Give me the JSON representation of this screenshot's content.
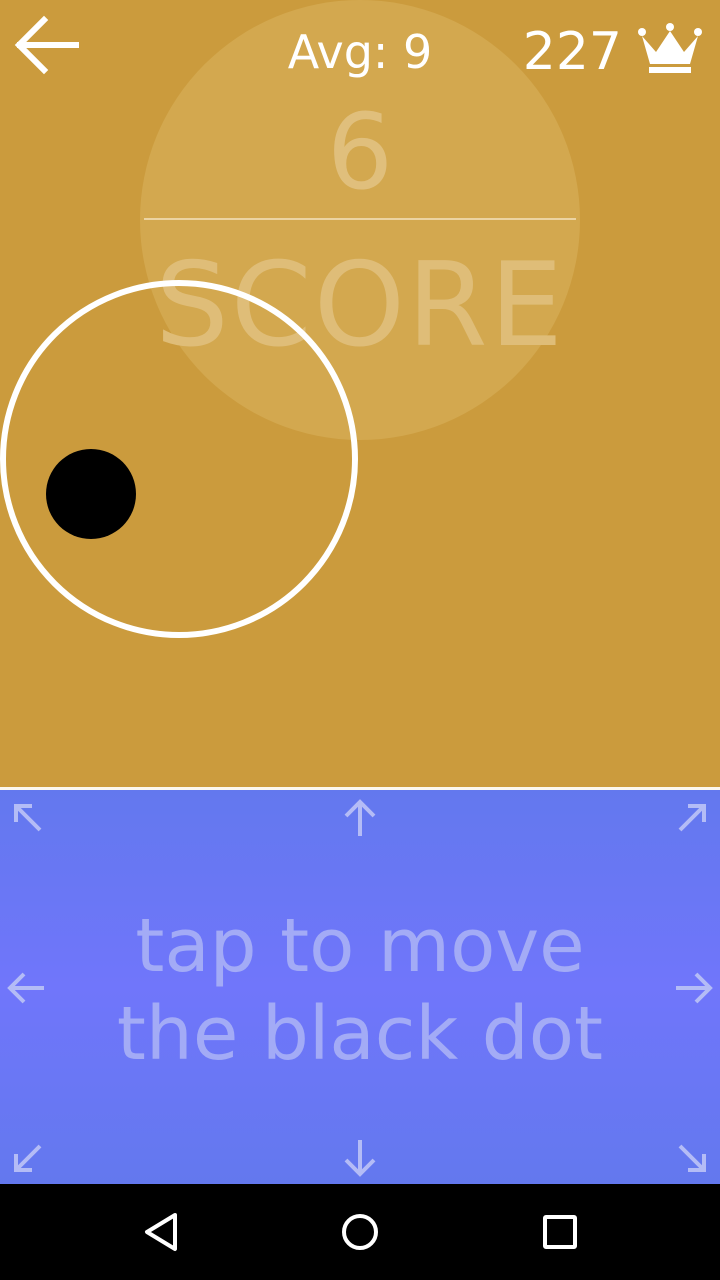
{
  "header": {
    "back_icon": "arrow-left-icon",
    "avg_text": "Avg: 9",
    "best_score": "227",
    "best_icon": "crown-icon"
  },
  "score_panel": {
    "value": "6",
    "label": "SCORE"
  },
  "game": {
    "ring_icon": "ring-target",
    "dot_icon": "black-dot"
  },
  "control_pad": {
    "hint_line1": "tap to move",
    "hint_line2": "the black dot",
    "arrows": [
      "arrow-up-left-icon",
      "arrow-up-icon",
      "arrow-up-right-icon",
      "arrow-left-icon",
      "arrow-right-icon",
      "arrow-down-left-icon",
      "arrow-down-icon",
      "arrow-down-right-icon"
    ]
  },
  "navbar": {
    "buttons": [
      "back-triangle-icon",
      "home-circle-icon",
      "recents-square-icon"
    ]
  },
  "colors": {
    "game_background": "#cb9b3d",
    "pad_background": "#6f77fa",
    "hint_text": "#a3abf6"
  }
}
